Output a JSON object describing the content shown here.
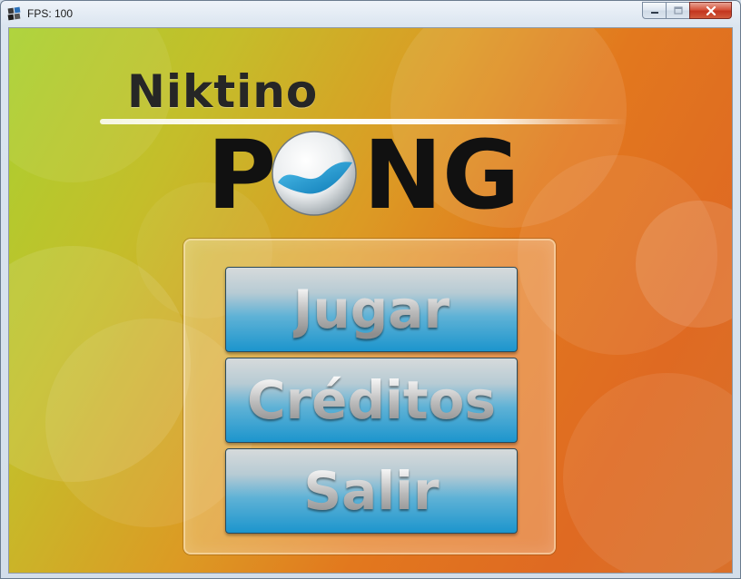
{
  "window": {
    "title": "FPS: 100"
  },
  "logo": {
    "brand": "Niktino",
    "word_start": "P",
    "word_end": "NG"
  },
  "menu": {
    "items": [
      {
        "label": "Jugar"
      },
      {
        "label": "Créditos"
      },
      {
        "label": "Salir"
      }
    ]
  },
  "colors": {
    "background_left": "#a9d130",
    "background_right": "#e2781e",
    "button_top": "#d6dadb",
    "button_bottom": "#1c95cd",
    "logo_text": "#111111",
    "logo_wave": "#1b93cf"
  }
}
